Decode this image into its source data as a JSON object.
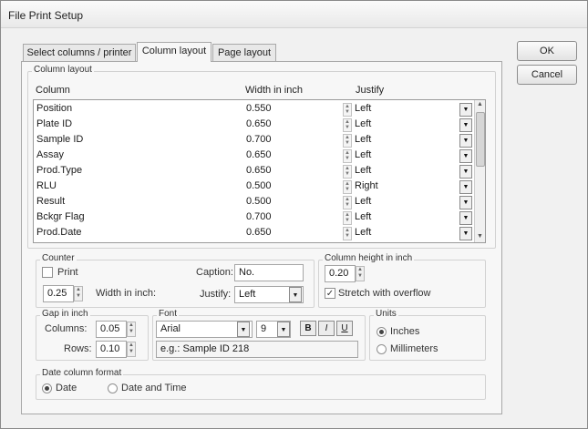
{
  "window": {
    "title": "File Print Setup"
  },
  "dialog_buttons": {
    "ok": "OK",
    "cancel": "Cancel"
  },
  "tabs": [
    "Select columns / printer",
    "Column layout",
    "Page layout"
  ],
  "active_tab": "Column layout",
  "column_layout": {
    "group_label": "Column layout",
    "headers": {
      "column": "Column",
      "width": "Width in inch",
      "justify": "Justify"
    },
    "rows": [
      {
        "column": "Position",
        "width": "0.550",
        "justify": "Left"
      },
      {
        "column": "Plate ID",
        "width": "0.650",
        "justify": "Left"
      },
      {
        "column": "Sample ID",
        "width": "0.700",
        "justify": "Left"
      },
      {
        "column": "Assay",
        "width": "0.650",
        "justify": "Left"
      },
      {
        "column": "Prod.Type",
        "width": "0.650",
        "justify": "Left"
      },
      {
        "column": "RLU",
        "width": "0.500",
        "justify": "Right"
      },
      {
        "column": "Result",
        "width": "0.500",
        "justify": "Left"
      },
      {
        "column": "Bckgr Flag",
        "width": "0.700",
        "justify": "Left"
      },
      {
        "column": "Prod.Date",
        "width": "0.650",
        "justify": "Left"
      }
    ]
  },
  "counter": {
    "group_label": "Counter",
    "print_label": "Print",
    "print_checked": false,
    "caption_label": "Caption:",
    "caption_value": "No.",
    "width_value": "0.25",
    "width_label": "Width in inch:",
    "justify_label": "Justify:",
    "justify_value": "Left"
  },
  "column_height": {
    "group_label": "Column height in inch",
    "value": "0.20",
    "stretch_label": "Stretch with overflow",
    "stretch_checked": true
  },
  "gap": {
    "group_label": "Gap in inch",
    "columns_label": "Columns:",
    "columns_value": "0.05",
    "rows_label": "Rows:",
    "rows_value": "0.10"
  },
  "font": {
    "group_label": "Font",
    "family": "Arial",
    "size": "9",
    "bold": "B",
    "italic": "I",
    "underline": "U",
    "sample": "e.g.: Sample ID 218"
  },
  "units": {
    "group_label": "Units",
    "inches": "Inches",
    "millimeters": "Millimeters",
    "selected": "Inches"
  },
  "date_format": {
    "group_label": "Date column format",
    "date": "Date",
    "date_time": "Date and Time",
    "selected": "Date"
  }
}
